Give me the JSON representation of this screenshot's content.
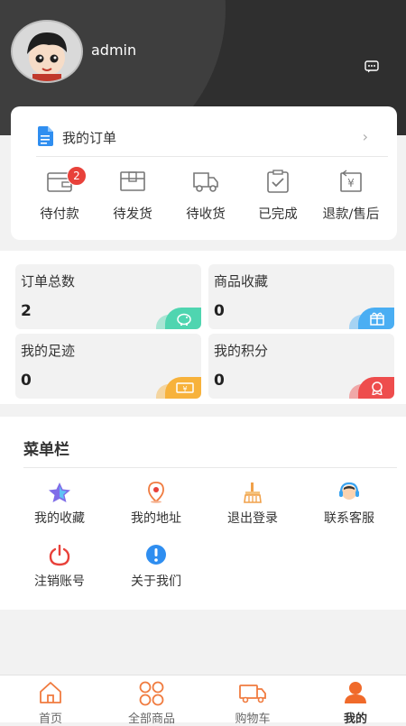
{
  "profile": {
    "username": "admin"
  },
  "icons": {
    "message": "message-icon",
    "orders": "document-icon"
  },
  "orders": {
    "title": "我的订单",
    "items": [
      {
        "label": "待付款",
        "icon": "wallet-icon",
        "badge": "2"
      },
      {
        "label": "待发货",
        "icon": "box-icon"
      },
      {
        "label": "待收货",
        "icon": "truck-icon"
      },
      {
        "label": "已完成",
        "icon": "clipboard-check-icon"
      },
      {
        "label": "退款/售后",
        "icon": "refund-icon"
      }
    ]
  },
  "stats": [
    {
      "title": "订单总数",
      "value": "2",
      "icon": "piggy-bank-icon",
      "color": "#4fd5b0"
    },
    {
      "title": "商品收藏",
      "value": "0",
      "icon": "gift-icon",
      "color": "#4aaef3"
    },
    {
      "title": "我的足迹",
      "value": "0",
      "icon": "ticket-icon",
      "color": "#f7b23b"
    },
    {
      "title": "我的积分",
      "value": "0",
      "icon": "medal-icon",
      "color": "#ee4d4d"
    }
  ],
  "menu": {
    "title": "菜单栏",
    "items": [
      {
        "label": "我的收藏",
        "icon": "star-icon"
      },
      {
        "label": "我的地址",
        "icon": "location-pin-icon"
      },
      {
        "label": "退出登录",
        "icon": "broom-icon"
      },
      {
        "label": "联系客服",
        "icon": "headset-icon"
      },
      {
        "label": "注销账号",
        "icon": "power-icon"
      },
      {
        "label": "关于我们",
        "icon": "info-icon"
      }
    ]
  },
  "tabbar": {
    "items": [
      {
        "label": "首页",
        "icon": "home-icon"
      },
      {
        "label": "全部商品",
        "icon": "grid-icon"
      },
      {
        "label": "购物车",
        "icon": "cart-truck-icon"
      },
      {
        "label": "我的",
        "icon": "user-icon",
        "active": true
      }
    ]
  },
  "colors": {
    "accent": "#f06a2a",
    "header": "#2f2f2f"
  }
}
